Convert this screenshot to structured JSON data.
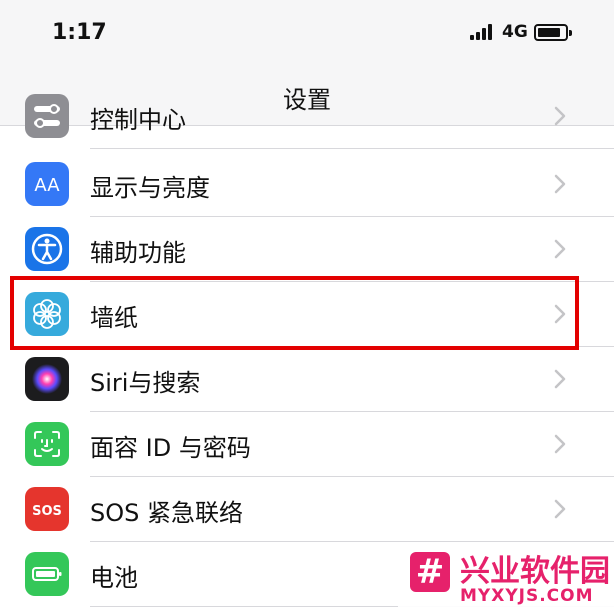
{
  "status_bar": {
    "time": "1:17",
    "network": "4G"
  },
  "nav": {
    "title": "设置"
  },
  "rows": [
    {
      "label": "控制中心",
      "icon": "control-center-icon",
      "color": "#8e8e93"
    },
    {
      "label": "显示与亮度",
      "icon": "display-brightness-icon",
      "color": "#3478f6"
    },
    {
      "label": "辅助功能",
      "icon": "accessibility-icon",
      "color": "#1a74e8"
    },
    {
      "label": "墙纸",
      "icon": "wallpaper-icon",
      "color": "#36aadc"
    },
    {
      "label": "Siri与搜索",
      "icon": "siri-icon",
      "color": "#1c1c1e"
    },
    {
      "label": "面容 ID 与密码",
      "icon": "face-id-icon",
      "color": "#34c759"
    },
    {
      "label": "SOS 紧急联络",
      "icon": "sos-icon",
      "color": "#e5352d"
    },
    {
      "label": "电池",
      "icon": "battery-icon",
      "color": "#34c759"
    }
  ],
  "icon_text": {
    "display": "AA",
    "sos": "SOS"
  },
  "highlight_color": "#e30000",
  "watermark": {
    "logo": "#",
    "title": "兴业软件园",
    "subtitle": "MYXYJS.COM",
    "color": "#e6216b"
  }
}
